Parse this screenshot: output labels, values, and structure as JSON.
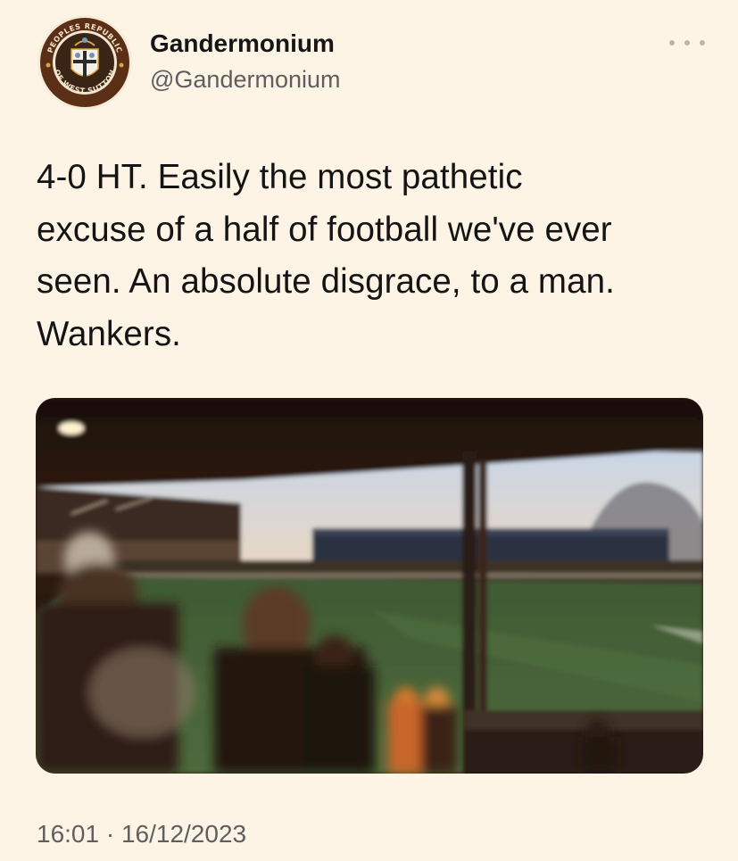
{
  "author": {
    "display_name": "Gandermonium",
    "handle": "@Gandermonium",
    "avatar_icon": "club-crest-icon",
    "avatar_ring_top_text": "PEOPLES REPUBLIC",
    "avatar_ring_bottom_text": "OF WEST SUTTON"
  },
  "more_button": {
    "icon": "more-options-icon"
  },
  "tweet": {
    "text": "4-0 HT. Easily the most pathetic\nexcuse of a half of football we've ever\nseen. An absolute disgrace, to a man.\nWankers.",
    "media_icon": "stadium-photo",
    "timestamp": "16:01 · 16/12/2023"
  },
  "colors": {
    "background": "#fdf4e6",
    "avatar_ring": "#6b3a1c",
    "crest_gold": "#d9a441"
  }
}
